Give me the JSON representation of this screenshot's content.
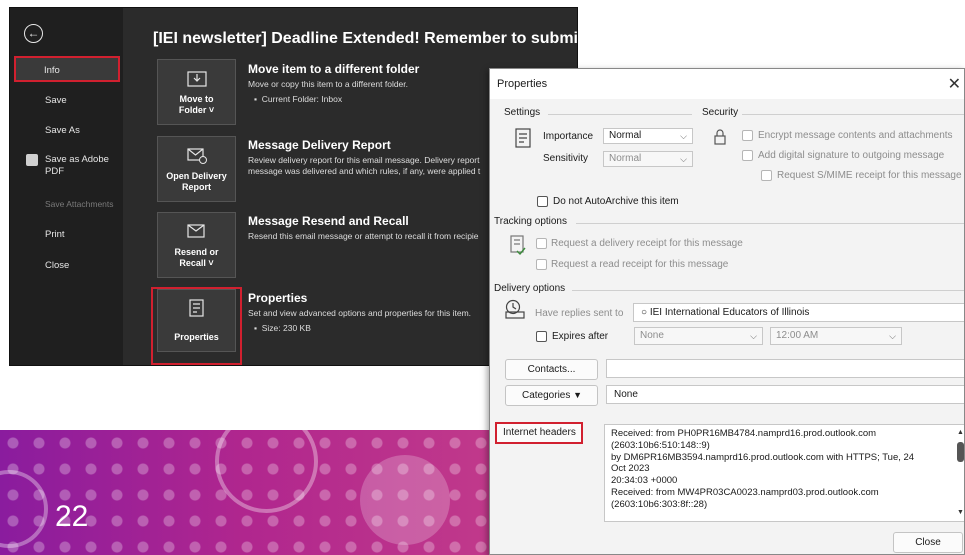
{
  "slide": {
    "page_number": "22"
  },
  "outlook": {
    "title": "[IEI newsletter] Deadline Extended! Remember to submit your pro",
    "nav": [
      "Info",
      "Save",
      "Save As",
      "Save as Adobe\nPDF",
      "Save Attachments",
      "Print",
      "Close"
    ],
    "tiles": [
      {
        "label": "Move to\nFolder ˅",
        "heading": "Move item to a different folder",
        "desc": "Move or copy this item to a different folder.",
        "bullet": "Current Folder:  Inbox"
      },
      {
        "label": "Open Delivery\nReport",
        "heading": "Message Delivery Report",
        "desc": "Review delivery report for this email message. Delivery report\nmessage was delivered and which rules, if any, were applied t",
        "bullet": ""
      },
      {
        "label": "Resend or\nRecall ˅",
        "heading": "Message Resend and Recall",
        "desc": "Resend this email message or attempt to recall it from recipie",
        "bullet": ""
      },
      {
        "label": "Properties",
        "heading": "Properties",
        "desc": "Set and view advanced options and properties for this item.",
        "bullet": "Size:  230 KB"
      }
    ]
  },
  "dialog": {
    "title": "Properties",
    "settings": {
      "group": "Settings",
      "importance_label": "Importance",
      "importance_value": "Normal",
      "sensitivity_label": "Sensitivity",
      "sensitivity_value": "Normal",
      "autoarchive": "Do not AutoArchive this item"
    },
    "security": {
      "group": "Security",
      "encrypt": "Encrypt message contents and attachments",
      "signature": "Add digital signature to outgoing message",
      "smime": "Request S/MIME receipt for this message"
    },
    "tracking": {
      "group": "Tracking options",
      "delivery": "Request a delivery receipt for this message",
      "read": "Request a read receipt for this message"
    },
    "delivery": {
      "group": "Delivery options",
      "replies_label": "Have replies sent to",
      "replies_value": "IEI International Educators of Illinois",
      "expires_label": "Expires after",
      "expires_date": "None",
      "expires_time": "12:00 AM"
    },
    "contacts_button": "Contacts...",
    "categories_button": "Categories",
    "categories_value": "None",
    "internet_headers_label": "Internet headers",
    "headers_lines": [
      "Received: from PH0PR16MB4784.namprd16.prod.outlook.com",
      "(2603:10b6:510:148::9)",
      " by DM6PR16MB3594.namprd16.prod.outlook.com with HTTPS; Tue, 24",
      "Oct 2023",
      " 20:34:03 +0000",
      "Received: from MW4PR03CA0023.namprd03.prod.outlook.com",
      "(2603:10b6:303:8f::28)"
    ],
    "close_button": "Close"
  }
}
